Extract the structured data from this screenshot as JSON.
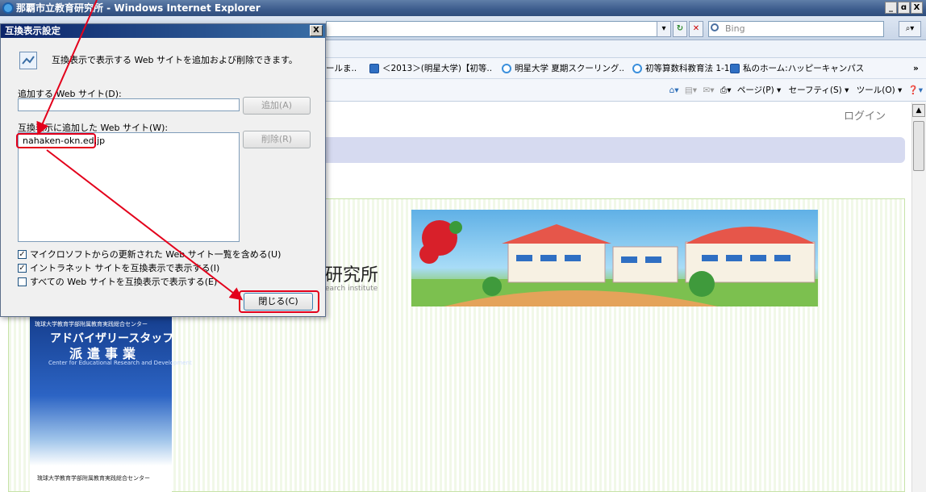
{
  "window": {
    "title": "那覇市立教育研究所 - Windows Internet Explorer",
    "min": "_",
    "max": "ɑ",
    "close": "X"
  },
  "search": {
    "placeholder": "Bing"
  },
  "favorites": [
    {
      "label": "ールま..",
      "icon": "none"
    },
    {
      "label": "＜2013＞(明星大学)【初等..",
      "icon": "blue"
    },
    {
      "label": "明星大学 夏期スクーリング..",
      "icon": "ie"
    },
    {
      "label": "初等算数科教育法 1-1",
      "icon": "ie"
    },
    {
      "label": "私のホーム:ハッピーキャンパス",
      "icon": "blue"
    }
  ],
  "command_bar": {
    "page": "ページ(P) ▾",
    "safety": "セーフティ(S) ▾",
    "tools": "ツール(O) ▾"
  },
  "page": {
    "login": "ログイン",
    "institute_text": "研究所",
    "institute_sub": "earch institute",
    "poster_line1": "琉球大学教育学部附属教育実践総合センター",
    "poster_title": "アドバイザリースタッフ",
    "poster_sub": "派遣事業",
    "poster_en": "Center for Educational Research and Development",
    "poster_foot": "琉球大学教育学部附属教育実践総合センター"
  },
  "dialog": {
    "title": "互換表示設定",
    "close": "X",
    "description": "互換表示で表示する Web サイトを追加および削除できます。",
    "add_label": "追加する Web サイト(D):",
    "add_value": "",
    "add_button": "追加(A)",
    "list_label": "互換表示に追加した Web サイト(W):",
    "list_items": [
      "nahaken-okn.ed.jp"
    ],
    "remove_button": "削除(R)",
    "checkbox1": "マイクロソフトからの更新された Web サイト一覧を含める(U)",
    "checkbox2": "イントラネット サイトを互換表示で表示する(I)",
    "checkbox3": "すべての Web サイトを互換表示で表示する(E)",
    "checkbox1_checked": true,
    "checkbox2_checked": true,
    "checkbox3_checked": false,
    "close_button": "閉じる(C)"
  },
  "colors": {
    "highlight": "#e3001b",
    "titlebar": "#0b246a"
  }
}
